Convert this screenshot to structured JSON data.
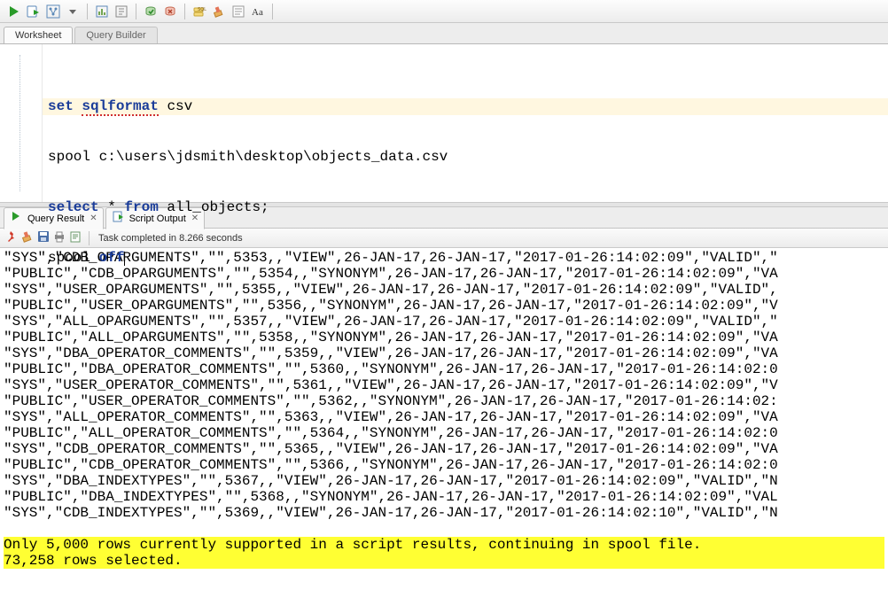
{
  "toolbar": {},
  "tabs": {
    "worksheet": "Worksheet",
    "querybuilder": "Query Builder"
  },
  "editor": {
    "line1_kw1": "set",
    "line1_kw2": "sqlformat",
    "line1_rest": " csv",
    "line2": "spool c:\\users\\jdsmith\\desktop\\objects_data.csv",
    "line3_kw1": "select",
    "line3_mid": " * ",
    "line3_kw2": "from",
    "line3_rest": " all_objects;",
    "line4_pre": "spool ",
    "line4_kw": "off"
  },
  "result_tabs": {
    "query_result": "Query Result",
    "script_output": "Script Output"
  },
  "status": {
    "task": "Task completed in 8.266 seconds"
  },
  "output_lines": [
    "\"SYS\",\"CDB_OPARGUMENTS\",\"\",5353,,\"VIEW\",26-JAN-17,26-JAN-17,\"2017-01-26:14:02:09\",\"VALID\",\"",
    "\"PUBLIC\",\"CDB_OPARGUMENTS\",\"\",5354,,\"SYNONYM\",26-JAN-17,26-JAN-17,\"2017-01-26:14:02:09\",\"VA",
    "\"SYS\",\"USER_OPARGUMENTS\",\"\",5355,,\"VIEW\",26-JAN-17,26-JAN-17,\"2017-01-26:14:02:09\",\"VALID\",",
    "\"PUBLIC\",\"USER_OPARGUMENTS\",\"\",5356,,\"SYNONYM\",26-JAN-17,26-JAN-17,\"2017-01-26:14:02:09\",\"V",
    "\"SYS\",\"ALL_OPARGUMENTS\",\"\",5357,,\"VIEW\",26-JAN-17,26-JAN-17,\"2017-01-26:14:02:09\",\"VALID\",\"",
    "\"PUBLIC\",\"ALL_OPARGUMENTS\",\"\",5358,,\"SYNONYM\",26-JAN-17,26-JAN-17,\"2017-01-26:14:02:09\",\"VA",
    "\"SYS\",\"DBA_OPERATOR_COMMENTS\",\"\",5359,,\"VIEW\",26-JAN-17,26-JAN-17,\"2017-01-26:14:02:09\",\"VA",
    "\"PUBLIC\",\"DBA_OPERATOR_COMMENTS\",\"\",5360,,\"SYNONYM\",26-JAN-17,26-JAN-17,\"2017-01-26:14:02:0",
    "\"SYS\",\"USER_OPERATOR_COMMENTS\",\"\",5361,,\"VIEW\",26-JAN-17,26-JAN-17,\"2017-01-26:14:02:09\",\"V",
    "\"PUBLIC\",\"USER_OPERATOR_COMMENTS\",\"\",5362,,\"SYNONYM\",26-JAN-17,26-JAN-17,\"2017-01-26:14:02:",
    "\"SYS\",\"ALL_OPERATOR_COMMENTS\",\"\",5363,,\"VIEW\",26-JAN-17,26-JAN-17,\"2017-01-26:14:02:09\",\"VA",
    "\"PUBLIC\",\"ALL_OPERATOR_COMMENTS\",\"\",5364,,\"SYNONYM\",26-JAN-17,26-JAN-17,\"2017-01-26:14:02:0",
    "\"SYS\",\"CDB_OPERATOR_COMMENTS\",\"\",5365,,\"VIEW\",26-JAN-17,26-JAN-17,\"2017-01-26:14:02:09\",\"VA",
    "\"PUBLIC\",\"CDB_OPERATOR_COMMENTS\",\"\",5366,,\"SYNONYM\",26-JAN-17,26-JAN-17,\"2017-01-26:14:02:0",
    "\"SYS\",\"DBA_INDEXTYPES\",\"\",5367,,\"VIEW\",26-JAN-17,26-JAN-17,\"2017-01-26:14:02:09\",\"VALID\",\"N",
    "\"PUBLIC\",\"DBA_INDEXTYPES\",\"\",5368,,\"SYNONYM\",26-JAN-17,26-JAN-17,\"2017-01-26:14:02:09\",\"VAL",
    "\"SYS\",\"CDB_INDEXTYPES\",\"\",5369,,\"VIEW\",26-JAN-17,26-JAN-17,\"2017-01-26:14:02:10\",\"VALID\",\"N"
  ],
  "output_footer": {
    "line1": "Only 5,000 rows currently supported in a script results, continuing in spool file.",
    "line2": "73,258 rows selected."
  }
}
